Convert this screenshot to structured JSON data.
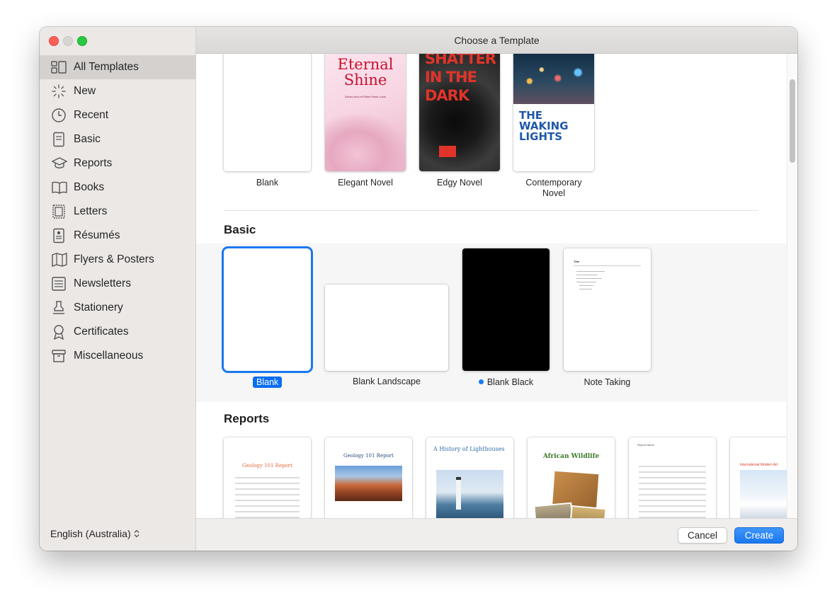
{
  "window": {
    "title": "Choose a Template"
  },
  "sidebar": {
    "items": [
      {
        "label": "All Templates",
        "icon": "all-templates-icon",
        "selected": true
      },
      {
        "label": "New",
        "icon": "new-sparkle-icon"
      },
      {
        "label": "Recent",
        "icon": "clock-icon"
      },
      {
        "label": "Basic",
        "icon": "document-icon"
      },
      {
        "label": "Reports",
        "icon": "graduation-cap-icon"
      },
      {
        "label": "Books",
        "icon": "book-icon"
      },
      {
        "label": "Letters",
        "icon": "letter-icon"
      },
      {
        "label": "Résumés",
        "icon": "resume-icon"
      },
      {
        "label": "Flyers & Posters",
        "icon": "map-icon"
      },
      {
        "label": "Newsletters",
        "icon": "newsletter-icon"
      },
      {
        "label": "Stationery",
        "icon": "stamp-icon"
      },
      {
        "label": "Certificates",
        "icon": "ribbon-icon"
      },
      {
        "label": "Miscellaneous",
        "icon": "archive-box-icon"
      }
    ],
    "language": "English (Australia)"
  },
  "books_row": {
    "items": [
      {
        "caption": "Blank"
      },
      {
        "caption": "Elegant Novel",
        "cover_title": "Eternal Shine",
        "cover_sub": "Donec Arcu et Etiam Hans Lotus"
      },
      {
        "caption": "Edgy Novel",
        "cover_title": "SHATTER IN THE DARK"
      },
      {
        "caption": "Contemporary Novel",
        "cover_title": "THE WAKING LIGHTS"
      }
    ]
  },
  "basic": {
    "title": "Basic",
    "items": [
      {
        "caption": "Blank",
        "selected": true
      },
      {
        "caption": "Blank Landscape"
      },
      {
        "caption": "Blank Black",
        "new_dot": true
      },
      {
        "caption": "Note Taking",
        "doc_title": "Title"
      }
    ]
  },
  "reports": {
    "title": "Reports",
    "items": [
      {
        "heading": "Geology 101 Report"
      },
      {
        "heading": "Geology 101 Report"
      },
      {
        "heading": "A History of Lighthouses"
      },
      {
        "heading": "African Wildlife"
      },
      {
        "heading": "Report Name"
      },
      {
        "heading": "International Modern Art"
      }
    ]
  },
  "footer": {
    "cancel": "Cancel",
    "create": "Create"
  },
  "colors": {
    "accent": "#0a6ef0",
    "sidebar_bg": "#ece8e6",
    "selected_row": "#d4d1cf"
  }
}
